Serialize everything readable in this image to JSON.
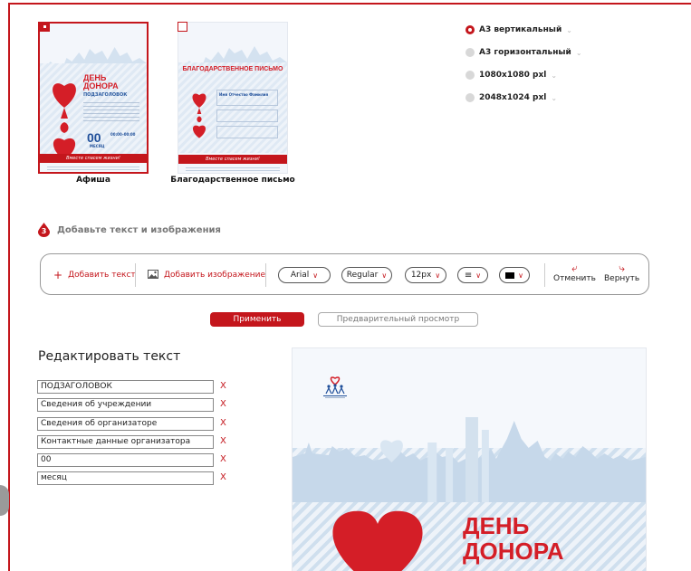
{
  "templates": [
    {
      "caption": "Афиша",
      "selected": true,
      "title": "ДЕНЬ ДОНОРА",
      "subtitle": "ПОДЗАГОЛОВОК",
      "date_number": "00",
      "month": "МЕСЯЦ",
      "time": "00:00–00:00",
      "slogan": "Вместе спасем жизни!"
    },
    {
      "caption": "Благодарственное письмо",
      "selected": false,
      "title": "БЛАГОДАРСТВЕННОЕ ПИСЬМО",
      "name": "Имя Отчество Фамилия",
      "slogan": "Вместе спасем жизни!"
    }
  ],
  "formats": [
    {
      "label": "А3 вертикальный",
      "selected": true
    },
    {
      "label": "А3 горизонтальный",
      "selected": false
    },
    {
      "label": "1080x1080 pxl",
      "selected": false
    },
    {
      "label": "2048x1024 pxl",
      "selected": false
    }
  ],
  "step": {
    "number": "3",
    "label": "Добавьте текст и изображения"
  },
  "toolbar": {
    "add_text": "Добавить текст",
    "add_image": "Добавить изображение",
    "font": "Arial",
    "weight": "Regular",
    "size": "12px",
    "undo": "Отменить",
    "redo": "Вернуть"
  },
  "buttons": {
    "apply": "Применить",
    "preview": "Предварительный просмотр"
  },
  "edit": {
    "title": "Редактировать текст",
    "delete_label": "X",
    "fields": [
      "ПОДЗАГОЛОВОК",
      "Сведения об учреждении",
      "Сведения об организаторе",
      "Контактные данные организатора",
      "00",
      "месяц"
    ]
  },
  "preview": {
    "title_line1": "ДЕНЬ",
    "title_line2": "ДОНОРА"
  },
  "colors": {
    "accent": "#c4161c",
    "sky": "#cfdfee"
  }
}
